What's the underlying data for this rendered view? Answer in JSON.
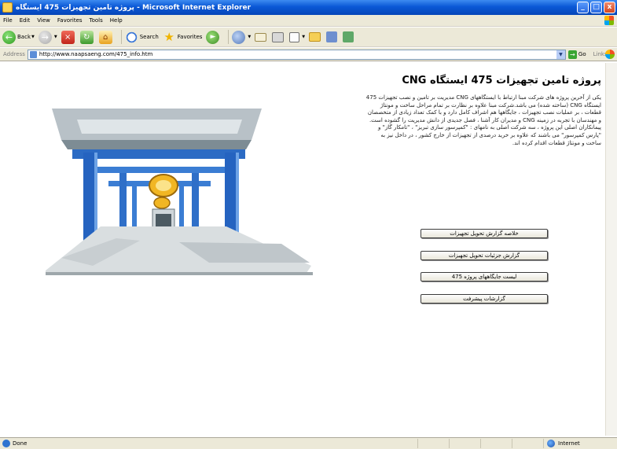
{
  "window": {
    "title": "پروژه تامین تجهیزات 475 ایستگاه - Microsoft Internet Explorer",
    "controls": [
      "_",
      "□",
      "x"
    ]
  },
  "menu": {
    "items": [
      "File",
      "Edit",
      "View",
      "Favorites",
      "Tools",
      "Help"
    ]
  },
  "toolbar": {
    "back_label": "Back",
    "search_label": "Search",
    "favorites_label": "Favorites"
  },
  "address": {
    "label": "Address",
    "url": "http://www.naapsaeng.com/475_info.htm",
    "go_label": "Go",
    "links_label": "Links"
  },
  "page": {
    "title": "پروژه تامین تجهیزات 475 ایستگاه CNG",
    "paragraph": "یکی از آخرین پروژه های شرکت مبنا ارتباط با ایستگاههای CNG مدیریت بر تامین و نصب تجهیزات 475 ایستگاه CNG (ساخته شده) می باشد.شرکت مبنا علاوه بر نظارت بر تمام مراحل ساخت و مونتاژ قطعات ، بر عملیات نصب تجهیزات ، جایگاهها هم اشراف کامل دارد و با کمک تعداد زیادی از متخصصان و مهندسان با تجربه در زمینه CNG و مدیران کار آشنا ، فصل جدیدی از دانش مدیریت را گشوده است. پیمانکاران اصلی این پروژه ، سه شرکت اصلی به نامهای : \"کمپرسور سازی تبریز\" ، \"تامکار گاز\" و \"پارس کمپرسور\" می باشند که علاوه بر خرید درصدی از تجهیزات از خارج کشور ، در داخل نیز به ساخت و مونتاژ قطعات اقدام کرده اند.",
    "buttons": [
      "خلاصه گزارش تحویل تجهیزات",
      "گزارش جزئیات تحویل تجهیزات",
      "لیست جایگاههای پروژه 475",
      "گزارشات پیشرفت"
    ]
  },
  "status": {
    "left": "Done",
    "zone": "Internet"
  }
}
